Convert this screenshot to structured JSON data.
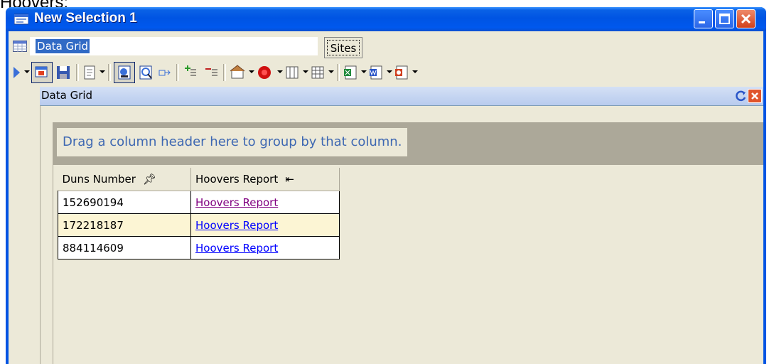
{
  "caption": "Hoovers:",
  "window": {
    "title": "New Selection 1",
    "buttons": [
      "minimize",
      "maximize",
      "close"
    ]
  },
  "namebar": {
    "name_value": "Data Grid",
    "sites_label": "Sites"
  },
  "toolbar": {
    "icons": [
      "run-icon",
      "copy-view-icon",
      "save-icon",
      "notepad-icon",
      "report-icon",
      "report-search-icon",
      "export-icon",
      "add-column-icon",
      "remove-column-icon",
      "properties-icon",
      "stop-icon",
      "columns-icon",
      "table-icon",
      "excel-icon",
      "word-icon",
      "powerpoint-icon"
    ]
  },
  "panel": {
    "title": "Data Grid"
  },
  "grid": {
    "group_hint": "Drag a column header here to group by that column.",
    "columns": [
      "Duns Number",
      "Hoovers Report"
    ],
    "rows": [
      {
        "duns": "152690194",
        "report": "Hoovers Report",
        "visited": true
      },
      {
        "duns": "172218187",
        "report": "Hoovers Report",
        "visited": false
      },
      {
        "duns": "884114609",
        "report": "Hoovers Report",
        "visited": false
      }
    ]
  },
  "colors": {
    "title_bar": "#0054e3",
    "client": "#ece9d8",
    "link": "#0000ff",
    "visited_link": "#800080",
    "group_hint_text": "#3e68b2",
    "alt_row": "#fcf5d4"
  }
}
